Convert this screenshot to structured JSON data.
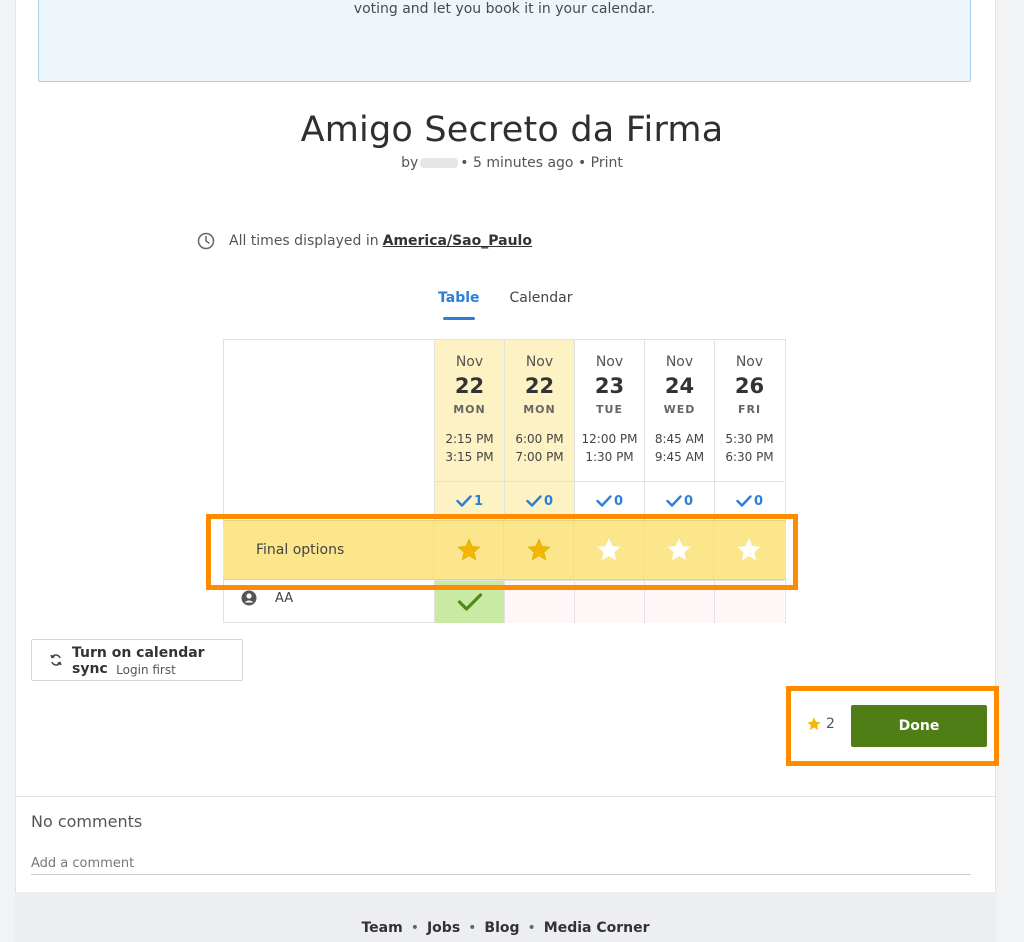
{
  "info_box": {
    "text": "voting and let you book it in your calendar."
  },
  "poll": {
    "title": "Amigo Secreto da Firma",
    "by_label": "by",
    "meta_rest": "• 5 minutes ago •",
    "print_label": "Print"
  },
  "timezone": {
    "prefix": "All times displayed in",
    "zone": "America/Sao_Paulo"
  },
  "tabs": [
    {
      "label": "Table"
    },
    {
      "label": "Calendar"
    }
  ],
  "columns": [
    {
      "month": "Nov",
      "day": "22",
      "dow": "MON",
      "start": "2:15 PM",
      "end": "3:15 PM",
      "count": "1",
      "selected": true,
      "final": true,
      "vote_yes": true
    },
    {
      "month": "Nov",
      "day": "22",
      "dow": "MON",
      "start": "6:00 PM",
      "end": "7:00 PM",
      "count": "0",
      "selected": true,
      "final": true,
      "vote_yes": false
    },
    {
      "month": "Nov",
      "day": "23",
      "dow": "TUE",
      "start": "12:00 PM",
      "end": "1:30 PM",
      "count": "0",
      "selected": false,
      "final": false,
      "vote_yes": false
    },
    {
      "month": "Nov",
      "day": "24",
      "dow": "WED",
      "start": "8:45 AM",
      "end": "9:45 AM",
      "count": "0",
      "selected": false,
      "final": false,
      "vote_yes": false
    },
    {
      "month": "Nov",
      "day": "26",
      "dow": "FRI",
      "start": "5:30 PM",
      "end": "6:30 PM",
      "count": "0",
      "selected": false,
      "final": false,
      "vote_yes": false
    }
  ],
  "final_row": {
    "label": "Final options"
  },
  "participant": {
    "name": "AA"
  },
  "sync": {
    "title": "Turn on calendar sync",
    "subtitle": "Login first"
  },
  "actions": {
    "star_count": "2",
    "done_label": "Done"
  },
  "comments": {
    "heading": "No comments",
    "placeholder": "Add a comment"
  },
  "footer": {
    "links": [
      "Team",
      "Jobs",
      "Blog",
      "Media Corner"
    ]
  },
  "colors": {
    "accent_blue": "#2c7fd8",
    "star_gold": "#f2b705",
    "done_green": "#4f7d16",
    "final_yellow": "#fce68c",
    "highlight_orange": "#ff8c00"
  }
}
